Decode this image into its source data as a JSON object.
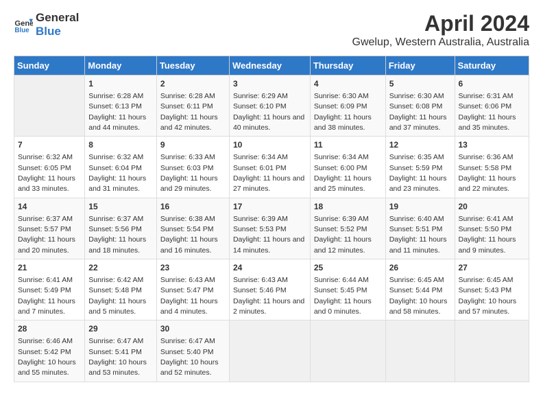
{
  "app": {
    "logo_line1": "General",
    "logo_line2": "Blue"
  },
  "title": "April 2024",
  "subtitle": "Gwelup, Western Australia, Australia",
  "columns": [
    "Sunday",
    "Monday",
    "Tuesday",
    "Wednesday",
    "Thursday",
    "Friday",
    "Saturday"
  ],
  "weeks": [
    [
      {
        "num": "",
        "sunrise": "",
        "sunset": "",
        "daylight": ""
      },
      {
        "num": "1",
        "sunrise": "Sunrise: 6:28 AM",
        "sunset": "Sunset: 6:13 PM",
        "daylight": "Daylight: 11 hours and 44 minutes."
      },
      {
        "num": "2",
        "sunrise": "Sunrise: 6:28 AM",
        "sunset": "Sunset: 6:11 PM",
        "daylight": "Daylight: 11 hours and 42 minutes."
      },
      {
        "num": "3",
        "sunrise": "Sunrise: 6:29 AM",
        "sunset": "Sunset: 6:10 PM",
        "daylight": "Daylight: 11 hours and 40 minutes."
      },
      {
        "num": "4",
        "sunrise": "Sunrise: 6:30 AM",
        "sunset": "Sunset: 6:09 PM",
        "daylight": "Daylight: 11 hours and 38 minutes."
      },
      {
        "num": "5",
        "sunrise": "Sunrise: 6:30 AM",
        "sunset": "Sunset: 6:08 PM",
        "daylight": "Daylight: 11 hours and 37 minutes."
      },
      {
        "num": "6",
        "sunrise": "Sunrise: 6:31 AM",
        "sunset": "Sunset: 6:06 PM",
        "daylight": "Daylight: 11 hours and 35 minutes."
      }
    ],
    [
      {
        "num": "7",
        "sunrise": "Sunrise: 6:32 AM",
        "sunset": "Sunset: 6:05 PM",
        "daylight": "Daylight: 11 hours and 33 minutes."
      },
      {
        "num": "8",
        "sunrise": "Sunrise: 6:32 AM",
        "sunset": "Sunset: 6:04 PM",
        "daylight": "Daylight: 11 hours and 31 minutes."
      },
      {
        "num": "9",
        "sunrise": "Sunrise: 6:33 AM",
        "sunset": "Sunset: 6:03 PM",
        "daylight": "Daylight: 11 hours and 29 minutes."
      },
      {
        "num": "10",
        "sunrise": "Sunrise: 6:34 AM",
        "sunset": "Sunset: 6:01 PM",
        "daylight": "Daylight: 11 hours and 27 minutes."
      },
      {
        "num": "11",
        "sunrise": "Sunrise: 6:34 AM",
        "sunset": "Sunset: 6:00 PM",
        "daylight": "Daylight: 11 hours and 25 minutes."
      },
      {
        "num": "12",
        "sunrise": "Sunrise: 6:35 AM",
        "sunset": "Sunset: 5:59 PM",
        "daylight": "Daylight: 11 hours and 23 minutes."
      },
      {
        "num": "13",
        "sunrise": "Sunrise: 6:36 AM",
        "sunset": "Sunset: 5:58 PM",
        "daylight": "Daylight: 11 hours and 22 minutes."
      }
    ],
    [
      {
        "num": "14",
        "sunrise": "Sunrise: 6:37 AM",
        "sunset": "Sunset: 5:57 PM",
        "daylight": "Daylight: 11 hours and 20 minutes."
      },
      {
        "num": "15",
        "sunrise": "Sunrise: 6:37 AM",
        "sunset": "Sunset: 5:56 PM",
        "daylight": "Daylight: 11 hours and 18 minutes."
      },
      {
        "num": "16",
        "sunrise": "Sunrise: 6:38 AM",
        "sunset": "Sunset: 5:54 PM",
        "daylight": "Daylight: 11 hours and 16 minutes."
      },
      {
        "num": "17",
        "sunrise": "Sunrise: 6:39 AM",
        "sunset": "Sunset: 5:53 PM",
        "daylight": "Daylight: 11 hours and 14 minutes."
      },
      {
        "num": "18",
        "sunrise": "Sunrise: 6:39 AM",
        "sunset": "Sunset: 5:52 PM",
        "daylight": "Daylight: 11 hours and 12 minutes."
      },
      {
        "num": "19",
        "sunrise": "Sunrise: 6:40 AM",
        "sunset": "Sunset: 5:51 PM",
        "daylight": "Daylight: 11 hours and 11 minutes."
      },
      {
        "num": "20",
        "sunrise": "Sunrise: 6:41 AM",
        "sunset": "Sunset: 5:50 PM",
        "daylight": "Daylight: 11 hours and 9 minutes."
      }
    ],
    [
      {
        "num": "21",
        "sunrise": "Sunrise: 6:41 AM",
        "sunset": "Sunset: 5:49 PM",
        "daylight": "Daylight: 11 hours and 7 minutes."
      },
      {
        "num": "22",
        "sunrise": "Sunrise: 6:42 AM",
        "sunset": "Sunset: 5:48 PM",
        "daylight": "Daylight: 11 hours and 5 minutes."
      },
      {
        "num": "23",
        "sunrise": "Sunrise: 6:43 AM",
        "sunset": "Sunset: 5:47 PM",
        "daylight": "Daylight: 11 hours and 4 minutes."
      },
      {
        "num": "24",
        "sunrise": "Sunrise: 6:43 AM",
        "sunset": "Sunset: 5:46 PM",
        "daylight": "Daylight: 11 hours and 2 minutes."
      },
      {
        "num": "25",
        "sunrise": "Sunrise: 6:44 AM",
        "sunset": "Sunset: 5:45 PM",
        "daylight": "Daylight: 11 hours and 0 minutes."
      },
      {
        "num": "26",
        "sunrise": "Sunrise: 6:45 AM",
        "sunset": "Sunset: 5:44 PM",
        "daylight": "Daylight: 10 hours and 58 minutes."
      },
      {
        "num": "27",
        "sunrise": "Sunrise: 6:45 AM",
        "sunset": "Sunset: 5:43 PM",
        "daylight": "Daylight: 10 hours and 57 minutes."
      }
    ],
    [
      {
        "num": "28",
        "sunrise": "Sunrise: 6:46 AM",
        "sunset": "Sunset: 5:42 PM",
        "daylight": "Daylight: 10 hours and 55 minutes."
      },
      {
        "num": "29",
        "sunrise": "Sunrise: 6:47 AM",
        "sunset": "Sunset: 5:41 PM",
        "daylight": "Daylight: 10 hours and 53 minutes."
      },
      {
        "num": "30",
        "sunrise": "Sunrise: 6:47 AM",
        "sunset": "Sunset: 5:40 PM",
        "daylight": "Daylight: 10 hours and 52 minutes."
      },
      {
        "num": "",
        "sunrise": "",
        "sunset": "",
        "daylight": ""
      },
      {
        "num": "",
        "sunrise": "",
        "sunset": "",
        "daylight": ""
      },
      {
        "num": "",
        "sunrise": "",
        "sunset": "",
        "daylight": ""
      },
      {
        "num": "",
        "sunrise": "",
        "sunset": "",
        "daylight": ""
      }
    ]
  ]
}
